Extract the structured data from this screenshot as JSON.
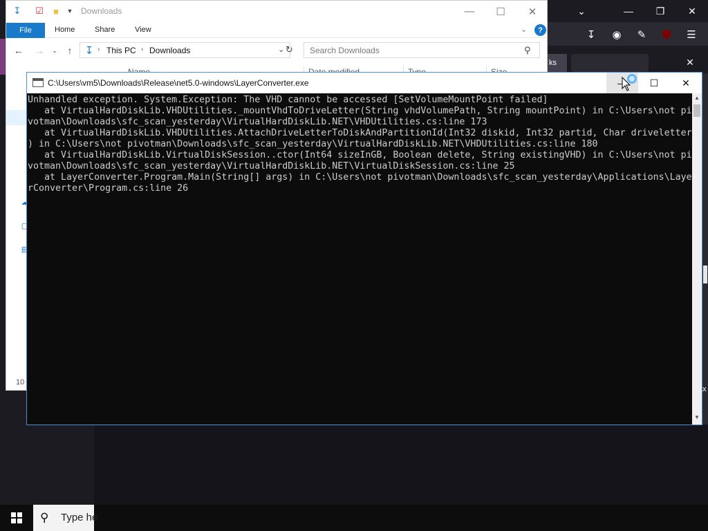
{
  "browser": {
    "tab_fragment": "ks",
    "right_text": "x"
  },
  "explorer": {
    "title": "Downloads",
    "ribbon": {
      "file": "File",
      "home": "Home",
      "share": "Share",
      "view": "View",
      "help": "?"
    },
    "address": {
      "this_pc": "This PC",
      "folder": "Downloads"
    },
    "search_placeholder": "Search Downloads",
    "columns": [
      "Name",
      "Date modified",
      "Type",
      "Size"
    ],
    "status_count": "10"
  },
  "console": {
    "title": "C:\\Users\\vm5\\Downloads\\Release\\net5.0-windows\\LayerConverter.exe",
    "lines": [
      "Unhandled exception. System.Exception: The VHD cannot be accessed [SetVolumeMountPoint failed]",
      "   at VirtualHardDiskLib.VHDUtilities._mountVhdToDriveLetter(String vhdVolumePath, String mountPoint) in C:\\Users\\not pi",
      "votman\\Downloads\\sfc_scan_yesterday\\VirtualHardDiskLib.NET\\VHDUtilities.cs:line 173",
      "   at VirtualHardDiskLib.VHDUtilities.AttachDriveLetterToDiskAndPartitionId(Int32 diskid, Int32 partid, Char driveletter",
      ") in C:\\Users\\not pivotman\\Downloads\\sfc_scan_yesterday\\VirtualHardDiskLib.NET\\VHDUtilities.cs:line 180",
      "   at VirtualHardDiskLib.VirtualDiskSession..ctor(Int64 sizeInGB, Boolean delete, String existingVHD) in C:\\Users\\not pi",
      "votman\\Downloads\\sfc_scan_yesterday\\VirtualHardDiskLib.NET\\VirtualDiskSession.cs:line 25",
      "   at LayerConverter.Program.Main(String[] args) in C:\\Users\\not pivotman\\Downloads\\sfc_scan_yesterday\\Applications\\Laye",
      "rConverter\\Program.cs:line 26"
    ]
  },
  "taskbar": {
    "search_text": "Type he"
  },
  "colors": {
    "accent": "#1979ca",
    "console_bg": "#0c0c0c",
    "console_text": "#cccccc",
    "browser_bg": "#1c1b22"
  }
}
